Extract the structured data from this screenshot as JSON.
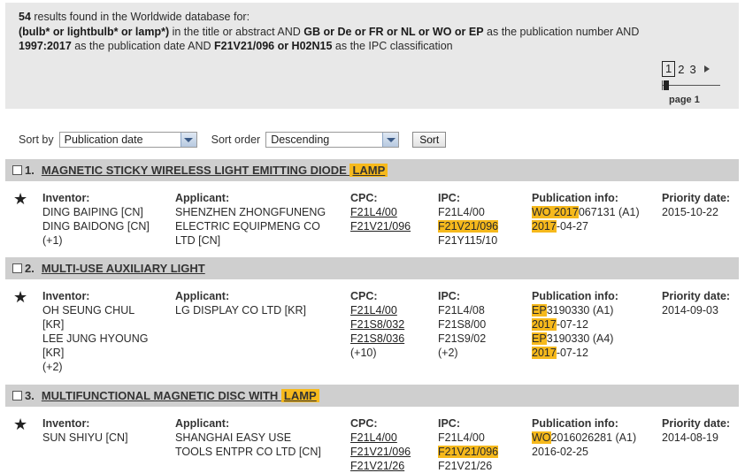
{
  "summary": {
    "count": "54",
    "line1_rest": " results found in the Worldwide database for:",
    "line2_bold_a": "(bulb* or lightbulb* or lamp*)",
    "line2_text_b": " in the title or abstract AND ",
    "line2_bold_c": "GB or De or FR or NL or WO or EP",
    "line2_text_d": " as the publication number AND",
    "line3_bold_a": "1997:2017",
    "line3_text_b": " as the publication date AND ",
    "line3_bold_c": "F21V21/096 or H02N15",
    "line3_text_d": " as the IPC classification"
  },
  "pager": {
    "pages": [
      "1",
      "2",
      "3"
    ],
    "active": "1",
    "page_label": "page 1"
  },
  "sort": {
    "sort_by_label": "Sort by",
    "sort_by_value": "Publication date",
    "sort_order_label": "Sort order",
    "sort_order_value": "Descending",
    "sort_button": "Sort"
  },
  "labels": {
    "inventor": "Inventor:",
    "applicant": "Applicant:",
    "cpc": "CPC:",
    "ipc": "IPC:",
    "pubinfo": "Publication info:",
    "priority": "Priority date:"
  },
  "results": [
    {
      "num": "1.",
      "title_a": "MAGNETIC STICKY WIRELESS LIGHT EMITTING DIODE ",
      "title_hl": "LAMP",
      "inventors": [
        "DING BAIPING  [CN]",
        "DING BAIDONG  [CN]",
        "(+1)"
      ],
      "applicant": [
        "SHENZHEN ZHONGFUNENG",
        "ELECTRIC EQUIPMENG CO",
        "LTD  [CN]"
      ],
      "cpc": [
        "F21L4/00",
        "F21V21/096"
      ],
      "ipc": [
        "F21L4/00",
        "F21V21/096",
        "F21Y115/10"
      ],
      "ipc_highlight_index": 1,
      "pub": [
        {
          "hl": "WO 2017",
          "rest": "067131 (A1)"
        },
        {
          "hl": "2017",
          "rest": "-04-27"
        }
      ],
      "priority": "2015-10-22"
    },
    {
      "num": "2.",
      "title_a": "MULTI-USE AUXILIARY LIGHT",
      "title_hl": "",
      "inventors": [
        "OH SEUNG CHUL",
        "[KR]",
        "LEE JUNG HYOUNG",
        "[KR]",
        "(+2)"
      ],
      "applicant": [
        "LG DISPLAY CO LTD  [KR]"
      ],
      "cpc": [
        "F21L4/00",
        "F21S8/032",
        "F21S8/036",
        "(+10)"
      ],
      "ipc": [
        "F21L4/08",
        "F21S8/00",
        "F21S9/02",
        "(+2)"
      ],
      "ipc_highlight_index": -1,
      "pub": [
        {
          "hl": "EP",
          "rest": "3190330 (A1)"
        },
        {
          "hl": "2017",
          "rest": "-07-12"
        },
        {
          "hl": "EP",
          "rest": "3190330 (A4)"
        },
        {
          "hl": "2017",
          "rest": "-07-12"
        }
      ],
      "priority": "2014-09-03"
    },
    {
      "num": "3.",
      "title_a": "MULTIFUNCTIONAL MAGNETIC DISC WITH ",
      "title_hl": "LAMP",
      "inventors": [
        "SUN SHIYU  [CN]"
      ],
      "applicant": [
        "SHANGHAI EASY USE",
        "TOOLS ENTPR CO LTD  [CN]"
      ],
      "cpc": [
        "F21L4/00",
        "F21V21/096",
        "F21V21/26"
      ],
      "ipc": [
        "F21L4/00",
        "F21V21/096",
        "F21V21/26"
      ],
      "ipc_highlight_index": 1,
      "pub": [
        {
          "hl": "WO",
          "rest": "2016026281 (A1)"
        },
        {
          "hl": "",
          "rest": "2016-02-25"
        }
      ],
      "priority": "2014-08-19"
    }
  ]
}
